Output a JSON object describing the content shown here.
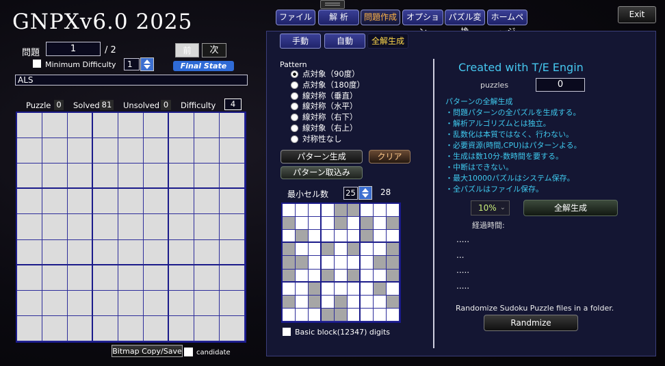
{
  "app": {
    "title": "GNPXv6.0 2025",
    "exit_label": "Exit"
  },
  "menu": [
    {
      "label": "ファイル",
      "active": false
    },
    {
      "label": "解 析",
      "active": false
    },
    {
      "label": "問題作成",
      "active": true
    },
    {
      "label": "オプション",
      "active": false
    },
    {
      "label": "パズル変換",
      "active": false
    },
    {
      "label": "ホームページ",
      "active": false
    }
  ],
  "left": {
    "problem_label": "問題",
    "problem_value": "1",
    "problem_total": "/ 2",
    "prev_label": "前",
    "next_label": "次",
    "min_difficulty_label": "Minimum Difficulty",
    "min_difficulty_value": "1",
    "final_state_label": "Final State",
    "als_text": "ALS",
    "stats": {
      "puzzle_label": "Puzzle",
      "puzzle_value": "0",
      "solved_label": "Solved",
      "solved_value": "81",
      "unsolved_label": "Unsolved",
      "unsolved_value": "0",
      "difficulty_label": "Difficulty",
      "difficulty_value": "4"
    },
    "bitmap_label": "Bitmap Copy/Save",
    "candidate_label": "candidate"
  },
  "subtabs": [
    {
      "label": "手動",
      "active": false
    },
    {
      "label": "自動",
      "active": false
    },
    {
      "label": "全解生成",
      "active": true
    }
  ],
  "pattern": {
    "title": "Pattern",
    "options": [
      "点対象（90度）",
      "点対象（180度）",
      "線対称（垂直）",
      "線対称（水平）",
      "線対称（右下）",
      "線対象（右上）",
      "対称性なし"
    ],
    "selected": 0,
    "generate_label": "パターン生成",
    "clear_label": "クリア",
    "import_label": "パターン取込み",
    "min_cells_label": "最小セル数",
    "min_cells_value": "25",
    "count": "28",
    "basic_block_label": "Basic block(12347) digits",
    "cells": [
      [
        0,
        0,
        0,
        0,
        1,
        1,
        0,
        0,
        0
      ],
      [
        1,
        0,
        0,
        0,
        1,
        0,
        1,
        0,
        1
      ],
      [
        0,
        1,
        0,
        0,
        0,
        0,
        1,
        0,
        0
      ],
      [
        1,
        0,
        0,
        1,
        0,
        1,
        0,
        0,
        1
      ],
      [
        1,
        1,
        0,
        0,
        0,
        0,
        0,
        1,
        1
      ],
      [
        1,
        0,
        0,
        1,
        0,
        1,
        0,
        0,
        1
      ],
      [
        0,
        0,
        1,
        0,
        0,
        0,
        0,
        1,
        0
      ],
      [
        1,
        0,
        1,
        0,
        1,
        0,
        0,
        0,
        1
      ],
      [
        0,
        0,
        0,
        1,
        1,
        0,
        0,
        0,
        0
      ]
    ]
  },
  "right": {
    "engine_title": "Created with T/E Engin",
    "puzzles_label": "puzzles",
    "puzzles_value": "0",
    "desc": [
      "パターンの全解生成",
      "・問題パターンの全パズルを生成する。",
      "・解析アルゴリズムとは独立。",
      "・乱数化は本質ではなく、行わない。",
      "・必要資源(時間,CPU)はパターンよる。",
      "・生成は数10分-数時間を要する。",
      "・中断はできない。",
      "・最大10000パズルはシステム保存。",
      "・全パズルはファイル保存。"
    ],
    "percent_value": "10%",
    "generate_all_label": "全解生成",
    "elapsed_label": "経過時間:",
    "dots": [
      ".....",
      "...",
      ".....",
      "....."
    ],
    "randomize_desc": "Randomize Sudoku Puzzle files in a folder.",
    "randomize_label": "Randmize"
  }
}
